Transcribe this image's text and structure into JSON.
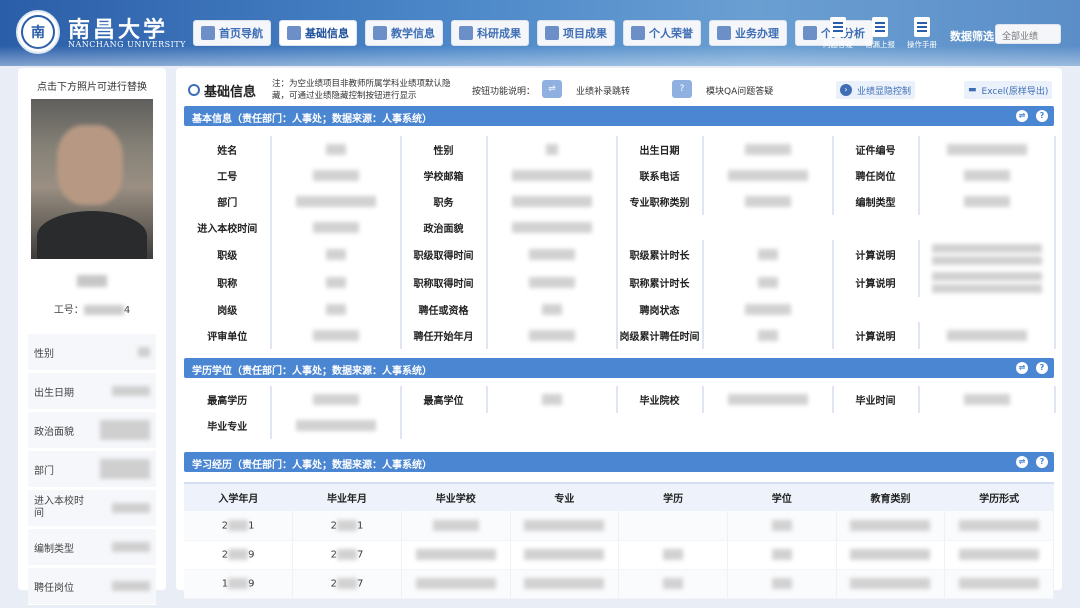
{
  "header": {
    "logo_char": "南",
    "university_cn": "南昌大学",
    "university_en": "NANCHANG UNIVERSITY",
    "nav": [
      "首页导航",
      "基础信息",
      "教学信息",
      "科研成果",
      "项目成果",
      "个人荣誉",
      "业务办理",
      "个人分析"
    ],
    "tools": [
      "问题答疑",
      "错漏上报",
      "操作手册"
    ],
    "filter_label": "数据筛选",
    "filter_value": "全部业绩"
  },
  "sidebar": {
    "photo_tip": "点击下方照片可进行替换",
    "empno_label": "工号：",
    "empno_suffix": "4",
    "fields": [
      "性别",
      "出生日期",
      "政治面貌",
      "部门",
      "进入本校时间",
      "编制类型",
      "聘任岗位"
    ]
  },
  "topbar": {
    "title": "基础信息",
    "note": "注：为空业绩项目非教师所属学科业绩项默认隐藏，可通过业绩隐藏控制按钮进行显示",
    "explain": "按钮功能说明：",
    "icon1": "⇌",
    "text1": "业绩补录跳转",
    "icon2": "?",
    "text2": "模块QA问题答疑",
    "btn1": "业绩显隐控制",
    "btn2": "Excel(原样导出)"
  },
  "sections": {
    "basic": "基本信息（责任部门：人事处；数据来源：人事系统）",
    "edu": "学历学位（责任部门：人事处；数据来源：人事系统）",
    "study": "学习经历（责任部门：人事处；数据来源：人事系统）"
  },
  "basic_labels": {
    "r1": [
      "姓名",
      "性别",
      "出生日期",
      "证件编号"
    ],
    "r2": [
      "工号",
      "学校邮箱",
      "联系电话",
      "聘任岗位"
    ],
    "r3": [
      "部门",
      "职务",
      "专业职称类别",
      "编制类型"
    ],
    "r4": [
      "进入本校时间",
      "政治面貌"
    ],
    "r5": [
      "职级",
      "职级取得时间",
      "职级累计时长",
      "计算说明"
    ],
    "r6": [
      "职称",
      "职称取得时间",
      "职称累计时长",
      "计算说明"
    ],
    "r7": [
      "岗级",
      "聘任或资格",
      "聘岗状态"
    ],
    "r8": [
      "评审单位",
      "聘任开始年月",
      "岗级累计聘任时间",
      "计算说明"
    ]
  },
  "edu_labels": {
    "r1": [
      "最高学历",
      "最高学位",
      "毕业院校",
      "毕业时间"
    ],
    "r2": [
      "毕业专业"
    ]
  },
  "study_headers": [
    "入学年月",
    "毕业年月",
    "毕业学校",
    "专业",
    "学历",
    "学位",
    "教育类别",
    "学历形式"
  ],
  "study_rows": [
    {
      "start_a": "2",
      "start_b": "1",
      "end_a": "2",
      "end_b": "1"
    },
    {
      "start_a": "2",
      "start_b": "9",
      "end_a": "2",
      "end_b": "7"
    },
    {
      "start_a": "1",
      "start_b": "9",
      "end_a": "2",
      "end_b": "7"
    }
  ]
}
